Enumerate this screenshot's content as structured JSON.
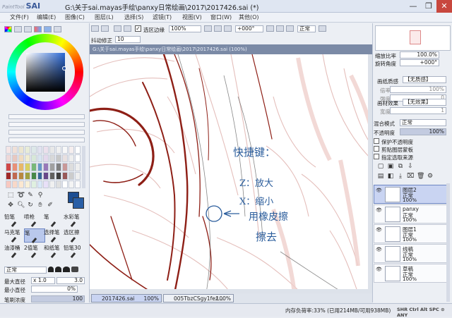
{
  "app": {
    "logo_small": "PaintTool",
    "logo_big": "SAI",
    "title": "G:\\关于sai.mayas手绘\\panxy日常绘画\\2017\\2017426.sai (*)"
  },
  "window_controls": {
    "minimize": "—",
    "restore": "❐",
    "close": "✕"
  },
  "menu": [
    "文件(F)",
    "编辑(E)",
    "图像(C)",
    "图层(L)",
    "选择(S)",
    "滤镜(T)",
    "视图(V)",
    "窗口(W)",
    "其他(O)"
  ],
  "toolbar": {
    "selection_edge_label": "选区边缘",
    "zoom": "100%",
    "rotation": "+000°",
    "blend": "正常",
    "stabilizer_label": "抖动修正",
    "stabilizer_value": "10"
  },
  "canvas_tab_title": "G:\\关于sai.mayas手绘\\panxy日常绘画\\2017\\2017426.sai (100%)",
  "canvas_annotation": {
    "title": "快捷键：",
    "line1": "Z：放大",
    "line2": "X：缩小",
    "line3": "用橡皮擦",
    "line4": "擦去"
  },
  "tools": {
    "brushes": [
      {
        "name": "铅笔"
      },
      {
        "name": "喷枪"
      },
      {
        "name": "笔"
      },
      {
        "name": "水彩笔"
      },
      {
        "name": "马克笔"
      },
      {
        "name": "笔"
      },
      {
        "name": "选择笔"
      },
      {
        "name": "选区擦"
      },
      {
        "name": "油漆桶"
      },
      {
        "name": "2值笔"
      },
      {
        "name": "和纸笔"
      },
      {
        "name": "铅笔30"
      }
    ],
    "blend_mode": "正常",
    "max_diameter_label": "最大直径",
    "max_diameter_mult": "x 1.0",
    "max_diameter_value": "3.0",
    "min_diameter_label": "最小直径",
    "min_diameter_value": "0%",
    "density_label": "笔刷浓度",
    "density_value": "100"
  },
  "primary_color": "#1c4e92",
  "right_panel": {
    "zoom_label": "缩放比率",
    "zoom_value": "100.0%",
    "angle_label": "旋转角度",
    "angle_value": "+000°",
    "texture_label": "画纸质感",
    "texture_value": "【无质感】",
    "texture_scale_label": "倍率",
    "texture_scale_value": "100%",
    "texture_intensity_label": "强度",
    "texture_intensity_value": "0",
    "effect_label": "画材效果",
    "effect_value": "【无效果】",
    "effect_width_label": "宽度",
    "effect_width_value": "1",
    "effect_intensity_label": "强度",
    "effect_intensity_value": "100",
    "blend_mode_label": "混合模式",
    "blend_mode_value": "正常",
    "opacity_label": "不透明度",
    "opacity_value": "100%",
    "opt_protect": "保护不透明度",
    "opt_clip": "剪贴图层蒙板",
    "opt_source": "指定选取来源"
  },
  "layers": [
    {
      "name": "图层2",
      "mode": "正常",
      "opacity": "100%",
      "selected": true
    },
    {
      "name": "panxy",
      "mode": "正常",
      "opacity": "100%",
      "selected": false
    },
    {
      "name": "图层1",
      "mode": "正常",
      "opacity": "100%",
      "selected": false
    },
    {
      "name": "线稿",
      "mode": "正常",
      "opacity": "100%",
      "selected": false
    },
    {
      "name": "草稿",
      "mode": "正常",
      "opacity": "100%",
      "selected": false
    }
  ],
  "doc_tabs": [
    {
      "name": "2017426.sai",
      "zoom": "100%"
    },
    {
      "name": "005TbzCSgy1fez...",
      "zoom": "100%"
    }
  ],
  "status": {
    "memory": "内存负荷率:33% (已用214MB/可用938MB)",
    "keys": "SHR Ctrl Alt SPC ⊙ ANY"
  }
}
